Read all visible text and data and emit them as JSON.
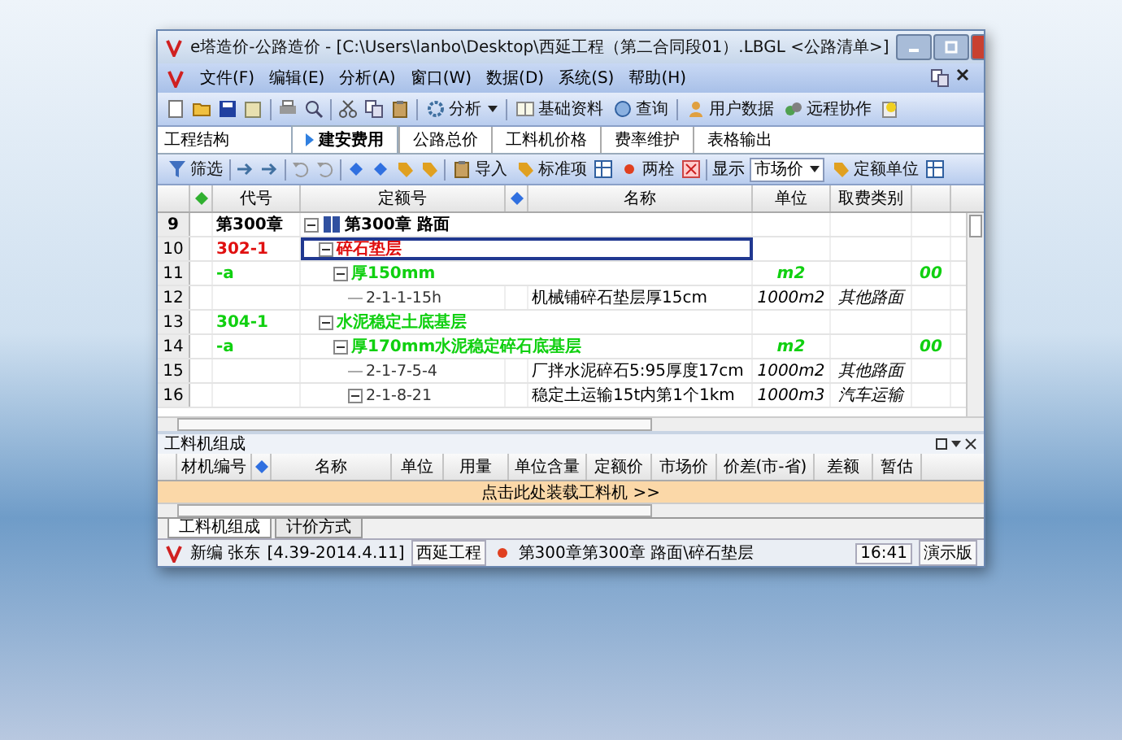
{
  "window": {
    "title": "e塔造价-公路造价 - [C:\\Users\\lanbo\\Desktop\\西延工程（第二合同段01）.LBGL <公路清单>]"
  },
  "menu": {
    "items": [
      "文件(F)",
      "编辑(E)",
      "分析(A)",
      "窗口(W)",
      "数据(D)",
      "系统(S)",
      "帮助(H)"
    ]
  },
  "toolbar": [
    {
      "kind": "icon"
    },
    {
      "kind": "icon"
    },
    {
      "kind": "icon"
    },
    {
      "kind": "icon"
    },
    {
      "kind": "sep"
    },
    {
      "kind": "icon"
    },
    {
      "kind": "icon"
    },
    {
      "kind": "sep"
    },
    {
      "kind": "icon"
    },
    {
      "kind": "icon"
    },
    {
      "kind": "icon"
    },
    {
      "kind": "sep"
    },
    {
      "kind": "menu",
      "label": "分析"
    },
    {
      "kind": "sep"
    },
    {
      "kind": "button",
      "label": "基础资料"
    },
    {
      "kind": "button",
      "label": "查询"
    },
    {
      "kind": "sep"
    },
    {
      "kind": "button",
      "label": "用户数据"
    },
    {
      "kind": "button",
      "label": "远程协作"
    },
    {
      "kind": "icon"
    }
  ],
  "side_panel": {
    "title": "工程结构"
  },
  "tabs": [
    {
      "label": "建安费用",
      "selected": true
    },
    {
      "label": "公路总价",
      "selected": false
    },
    {
      "label": "工料机价格",
      "selected": false
    },
    {
      "label": "费率维护",
      "selected": false
    },
    {
      "label": "表格输出",
      "selected": false
    }
  ],
  "toolbar_2": [
    {
      "kind": "button",
      "label": "筛选"
    },
    {
      "kind": "sep"
    },
    {
      "kind": "icon"
    },
    {
      "kind": "icon"
    },
    {
      "kind": "sep"
    },
    {
      "kind": "icon"
    },
    {
      "kind": "icon"
    },
    {
      "kind": "sep"
    },
    {
      "kind": "icon"
    },
    {
      "kind": "icon"
    },
    {
      "kind": "icon"
    },
    {
      "kind": "icon"
    },
    {
      "kind": "sep"
    },
    {
      "kind": "button",
      "label": "导入"
    },
    {
      "kind": "button",
      "label": "标准项"
    },
    {
      "kind": "icon"
    },
    {
      "kind": "button",
      "label": "两栓"
    },
    {
      "kind": "icon"
    },
    {
      "kind": "sep"
    },
    {
      "kind": "text",
      "label": "显示"
    },
    {
      "kind": "select",
      "label": "市场价"
    },
    {
      "kind": "button",
      "label": "定额单位"
    },
    {
      "kind": "icon"
    }
  ],
  "table": {
    "columns": [
      "代号",
      "定额号",
      "名称",
      "单位",
      "取费类别"
    ],
    "rows": [
      {
        "number": "9",
        "kind": "chapter",
        "code": "第300章",
        "quota": "第300章 路面",
        "expanded": true,
        "selected": false,
        "children": [
          {
            "number": "10",
            "kind": "item",
            "code": "302-1",
            "quota": "碎石垫层",
            "expanded": true,
            "selected": true,
            "children": [
              {
                "number": "11",
                "kind": "subitem",
                "code": "-a",
                "quota": "厚150mm",
                "unit": "m2",
                "column_6": "00",
                "expanded": true,
                "selected": false,
                "children": [
                  {
                    "number": "12",
                    "kind": "quota",
                    "quota": "2-1-1-15h",
                    "name": "机械铺碎石垫层厚15cm",
                    "unit": "1000m2",
                    "fee_type": "其他路面",
                    "expanded": false,
                    "selected": false
                  }
                ]
              }
            ]
          },
          {
            "number": "13",
            "kind": "subitem",
            "code": "304-1",
            "quota": "水泥稳定土底基层",
            "expanded": true,
            "selected": false,
            "children": [
              {
                "number": "14",
                "kind": "subitem",
                "code": "-a",
                "quota": "厚170mm水泥稳定碎石底基层",
                "unit": "m2",
                "column_6": "00",
                "expanded": true,
                "selected": false,
                "children": [
                  {
                    "number": "15",
                    "kind": "quota",
                    "quota": "2-1-7-5-4",
                    "name": "厂拌水泥碎石5:95厚度17cm",
                    "unit": "1000m2",
                    "fee_type": "其他路面",
                    "expanded": false,
                    "selected": false
                  },
                  {
                    "number": "16",
                    "kind": "quota",
                    "quota": "2-1-8-21",
                    "name": "稳定土运输15t内第1个1km",
                    "unit": "1000m3",
                    "fee_type": "汽车运输",
                    "expanded": true,
                    "selected": false
                  }
                ]
              }
            ]
          }
        ]
      }
    ]
  },
  "bottom_panel": {
    "title": "工料机组成",
    "columns": [
      "材机编号",
      "名称",
      "单位",
      "用量",
      "单位含量",
      "定额价",
      "市场价",
      "价差(市-省)",
      "差额",
      "暂估"
    ],
    "load_row": "点击此处装载工料机 >>",
    "tabs": [
      {
        "label": "工料机组成",
        "selected": true
      },
      {
        "label": "计价方式",
        "selected": false
      }
    ]
  },
  "status_bar": {
    "user": "新编 张东",
    "version": "[4.39-2014.4.11]",
    "project": "西延工程",
    "path": "第300章第300章 路面\\碎石垫层",
    "time": "16:41",
    "edition": "演示版"
  }
}
